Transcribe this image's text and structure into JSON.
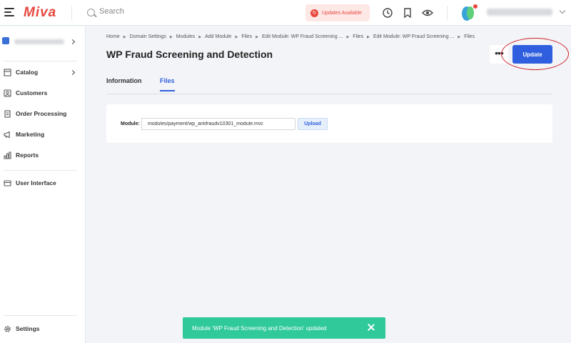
{
  "app": {
    "logo_text": "Miva",
    "brand_color": "#e8473d",
    "accent_color": "#2f5fde"
  },
  "header": {
    "search_placeholder": "Search",
    "updates_label": "Updates Available",
    "icons": [
      "history-icon",
      "bookmark-icon",
      "eye-icon",
      "avatar"
    ]
  },
  "sidebar": {
    "items": [
      {
        "label": "Catalog",
        "icon": "catalog-icon",
        "has_children": true
      },
      {
        "label": "Customers",
        "icon": "customers-icon"
      },
      {
        "label": "Order Processing",
        "icon": "order-processing-icon"
      },
      {
        "label": "Marketing",
        "icon": "megaphone-icon"
      },
      {
        "label": "Reports",
        "icon": "bar-chart-icon"
      },
      {
        "label": "User Interface",
        "icon": "user-interface-icon"
      }
    ],
    "settings_label": "Settings"
  },
  "breadcrumb": [
    "Home",
    "Domain Settings",
    "Modules",
    "Add Module",
    "Files",
    "Edit Module: WP Fraud Screening ...",
    "Files",
    "Edit Module: WP Fraud Screening ...",
    "Files"
  ],
  "page": {
    "title": "WP Fraud Screening and Detection",
    "update_label": "Update",
    "more_label": "•••"
  },
  "tabs": [
    {
      "label": "Information",
      "active": false
    },
    {
      "label": "Files",
      "active": true
    }
  ],
  "files_card": {
    "module_label": "Module:",
    "module_value": "modules/payment/wp_antifraudv10301_module.mvc",
    "upload_label": "Upload"
  },
  "toast": {
    "message": "Module 'WP Fraud Screening and Detection' updated",
    "color": "#2fc99a"
  }
}
